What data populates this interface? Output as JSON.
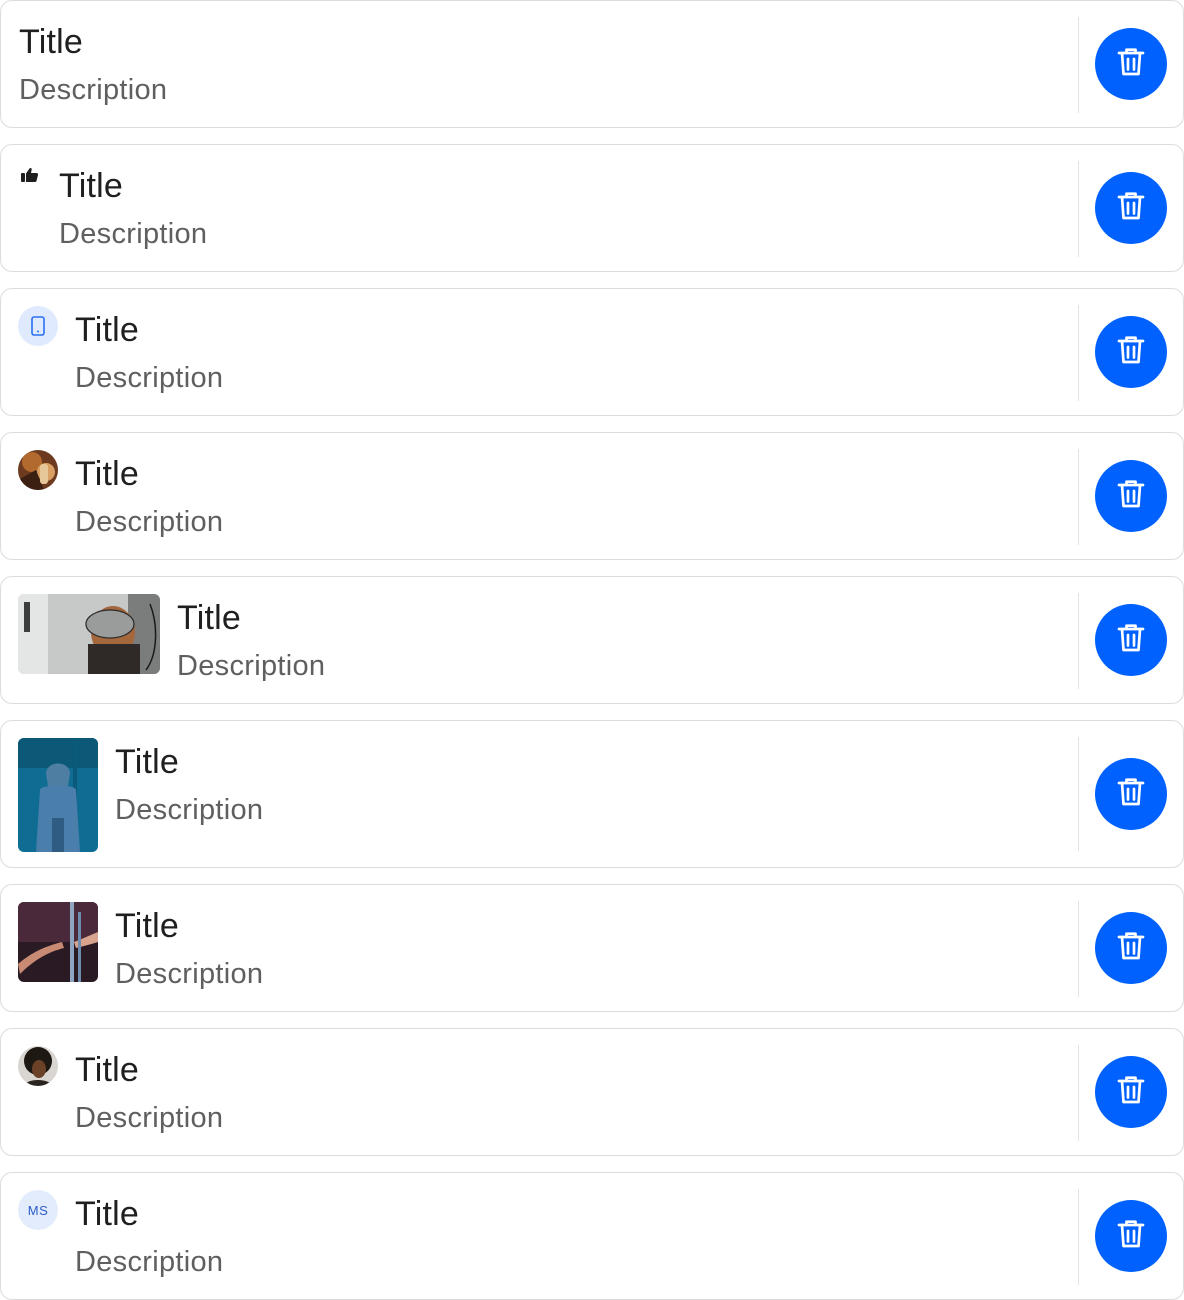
{
  "delete_action": {
    "icon": "trash-icon",
    "color": "#0061fe"
  },
  "items": [
    {
      "title": "Title",
      "description": "Description",
      "leading": "none"
    },
    {
      "title": "Title",
      "description": "Description",
      "leading": "thumbs-up-icon"
    },
    {
      "title": "Title",
      "description": "Description",
      "leading": "mobile-icon"
    },
    {
      "title": "Title",
      "description": "Description",
      "leading": "avatar-photo"
    },
    {
      "title": "Title",
      "description": "Description",
      "leading": "landscape-image"
    },
    {
      "title": "Title",
      "description": "Description",
      "leading": "portrait-image"
    },
    {
      "title": "Title",
      "description": "Description",
      "leading": "square-image"
    },
    {
      "title": "Title",
      "description": "Description",
      "leading": "avatar-photo"
    },
    {
      "title": "Title",
      "description": "Description",
      "leading": "initials-avatar",
      "initials": "MS"
    }
  ]
}
